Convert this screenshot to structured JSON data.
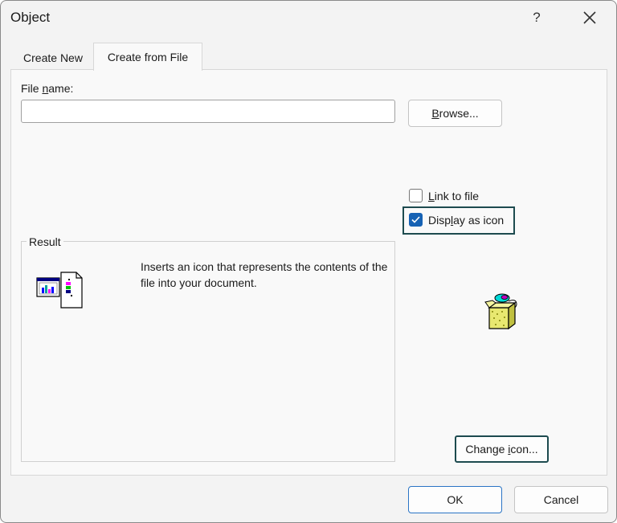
{
  "dialog": {
    "title": "Object",
    "help_label": "?",
    "close_label": "close"
  },
  "tabs": [
    {
      "label": "Create New",
      "active": false
    },
    {
      "label": "Create from File",
      "active": true
    }
  ],
  "file_name": {
    "label_pre": "File ",
    "label_access": "n",
    "label_post": "ame:",
    "value": "",
    "placeholder": ""
  },
  "browse_button": {
    "access": "B",
    "rest": "rowse..."
  },
  "link_to_file": {
    "access": "L",
    "rest": "ink to file",
    "checked": false
  },
  "display_as_icon": {
    "pre": "Disp",
    "access": "l",
    "post": "ay as icon",
    "checked": true
  },
  "result": {
    "legend": "Result",
    "text": "Inserts an icon that represents the contents of the file into your document."
  },
  "change_icon_button": {
    "pre": "Change ",
    "access": "i",
    "post": "con..."
  },
  "ok_label": "OK",
  "cancel_label": "Cancel",
  "icons": {
    "result_icon": "embedded-object-icon",
    "package_icon": "package-icon"
  },
  "colors": {
    "accent": "#1662b4",
    "focus": "#1d4b4f"
  }
}
